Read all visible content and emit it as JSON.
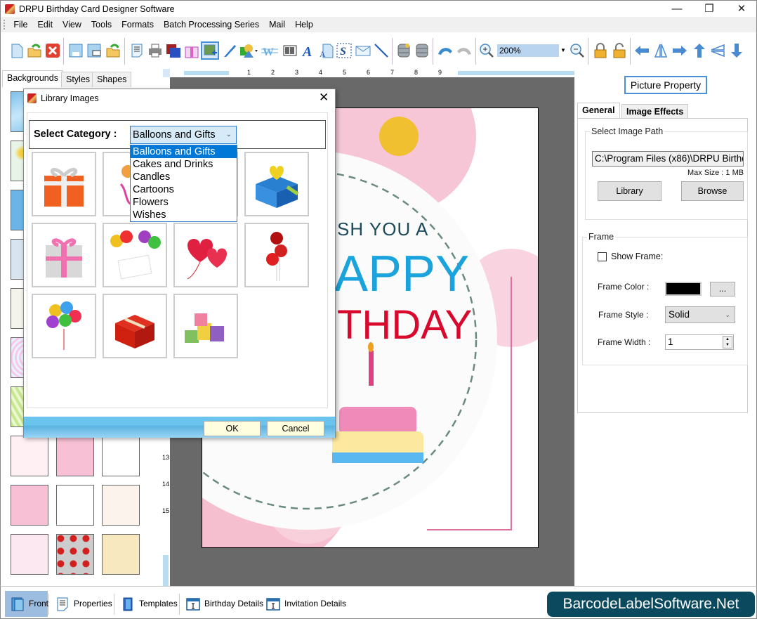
{
  "window": {
    "title": "DRPU Birthday Card Designer Software",
    "controls": [
      "minimize",
      "restore",
      "close"
    ]
  },
  "menu": {
    "items": [
      "File",
      "Edit",
      "View",
      "Tools",
      "Formats",
      "Batch Processing Series",
      "Mail",
      "Help"
    ]
  },
  "toolbar": {
    "groups": [
      [
        "new-icon",
        "open-icon",
        "close-icon"
      ],
      [
        "save-icon",
        "save-as-icon",
        "export-icon"
      ],
      [
        "properties-icon",
        "print-icon",
        "background-icon",
        "gift-icon",
        "insert-picture-icon",
        "pen-icon",
        "shapes-icon",
        "watermark-icon",
        "barcode-icon",
        "text-icon",
        "text-box-icon",
        "signature-icon",
        "mail-icon",
        "line-icon"
      ],
      [
        "database-settings-icon",
        "database-icon"
      ],
      [
        "undo-icon",
        "redo-icon"
      ],
      [
        "zoom-in-icon",
        "zoom-out-icon"
      ],
      [
        "lock-icon",
        "unlock-icon"
      ],
      [
        "align-left-icon",
        "flip-horizontal-icon",
        "align-right-icon",
        "align-top-icon",
        "flip-vertical-icon",
        "align-bottom-icon"
      ]
    ],
    "zoom_value": "200%"
  },
  "left_panel": {
    "tabs": [
      "Backgrounds",
      "Styles",
      "Shapes"
    ],
    "active_tab": "Backgrounds"
  },
  "ruler": {
    "top_labels": [
      "1",
      "2",
      "3",
      "4",
      "5",
      "6",
      "7",
      "8",
      "9"
    ],
    "left_labels": [
      "13",
      "14",
      "15"
    ]
  },
  "card": {
    "line1": "SH YOU A",
    "line2": "APPY",
    "line3": "THDAY",
    "colors": {
      "line1": "#1d4a5a",
      "line2": "#1aa3dc",
      "line3": "#d9092e"
    }
  },
  "right_panel": {
    "header": "Picture Property",
    "tabs": [
      "General",
      "Image Effects"
    ],
    "active_tab": "General",
    "image_path_group": "Select Image Path",
    "image_path_value": "C:\\Program Files (x86)\\DRPU Birthd",
    "max_size": "Max Size : 1 MB",
    "library_button": "Library",
    "browse_button": "Browse",
    "frame_group": "Frame",
    "show_frame_label": "Show Frame:",
    "show_frame_checked": false,
    "frame_color_label": "Frame Color :",
    "frame_color_value": "#000000",
    "frame_color_button": "...",
    "frame_style_label": "Frame Style :",
    "frame_style_value": "Solid",
    "frame_width_label": "Frame Width :",
    "frame_width_value": "1"
  },
  "bottom_bar": {
    "items": [
      "Front",
      "Properties",
      "Templates",
      "Birthday Details",
      "Invitation Details"
    ],
    "active": "Front"
  },
  "brand": "BarcodeLabelSoftware.Net",
  "dialog": {
    "title": "Library Images",
    "category_label": "Select Category :",
    "category_value": "Balloons and Gifts",
    "category_options": [
      "Balloons and Gifts",
      "Cakes and Drinks",
      "Candles",
      "Cartoons",
      "Flowers",
      "Wishes"
    ],
    "images": [
      "orange-gift-box",
      "colorful-balloons",
      "hidden-by-dropdown",
      "hidden-by-dropdown",
      "blue-gift-box-with-hearts",
      "pink-gift-box",
      "balloons-happy-birthday-card",
      "red-heart-balloons",
      "red-balloons",
      "multicolor-balloons-bunch",
      "red-gift-box",
      "pile-of-gifts"
    ],
    "ok_button": "OK",
    "cancel_button": "Cancel"
  }
}
